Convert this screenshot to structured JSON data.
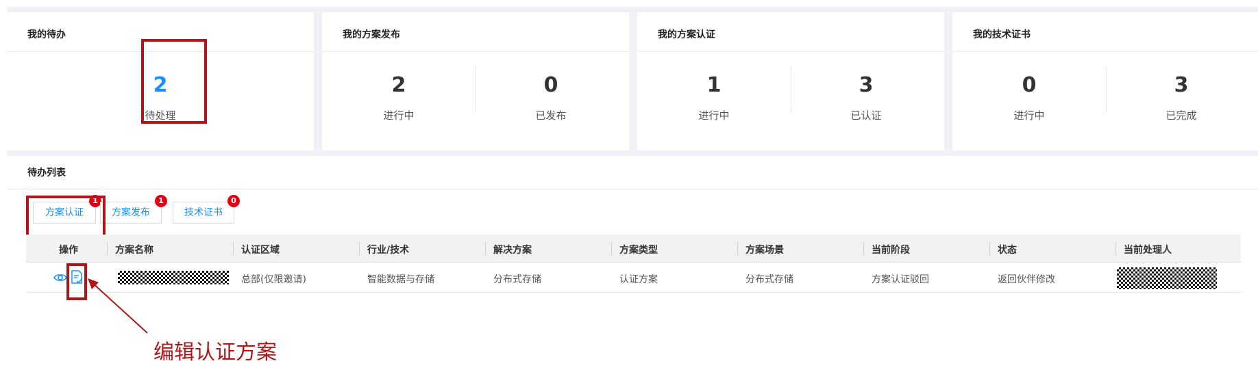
{
  "cards": [
    {
      "title": "我的待办",
      "stats": [
        {
          "value": "2",
          "label": "待处理"
        }
      ]
    },
    {
      "title": "我的方案发布",
      "stats": [
        {
          "value": "2",
          "label": "进行中"
        },
        {
          "value": "0",
          "label": "已发布"
        }
      ]
    },
    {
      "title": "我的方案认证",
      "stats": [
        {
          "value": "1",
          "label": "进行中"
        },
        {
          "value": "3",
          "label": "已认证"
        }
      ]
    },
    {
      "title": "我的技术证书",
      "stats": [
        {
          "value": "0",
          "label": "进行中"
        },
        {
          "value": "3",
          "label": "已完成"
        }
      ]
    }
  ],
  "todo_list": {
    "title": "待办列表",
    "tabs": [
      {
        "label": "方案认证",
        "badge": "1"
      },
      {
        "label": "方案发布",
        "badge": "1"
      },
      {
        "label": "技术证书",
        "badge": "0"
      }
    ],
    "columns": [
      "操作",
      "方案名称",
      "认证区域",
      "行业/技术",
      "解决方案",
      "方案类型",
      "方案场景",
      "当前阶段",
      "状态",
      "当前处理人"
    ],
    "rows": [
      {
        "actions": [
          "eye-icon",
          "edit-doc-icon"
        ],
        "name_masked": true,
        "region": "总部(仅限邀请)",
        "industry": "智能数据与存储",
        "solution": "分布式存储",
        "type": "认证方案",
        "scene": "分布式存储",
        "stage": "方案认证驳回",
        "status": "返回伙伴修改",
        "handler_masked": true
      }
    ]
  },
  "annotation": {
    "text": "编辑认证方案"
  },
  "colors": {
    "accent": "#1890ff",
    "highlight": "#b0151a",
    "badge": "#e60012"
  }
}
